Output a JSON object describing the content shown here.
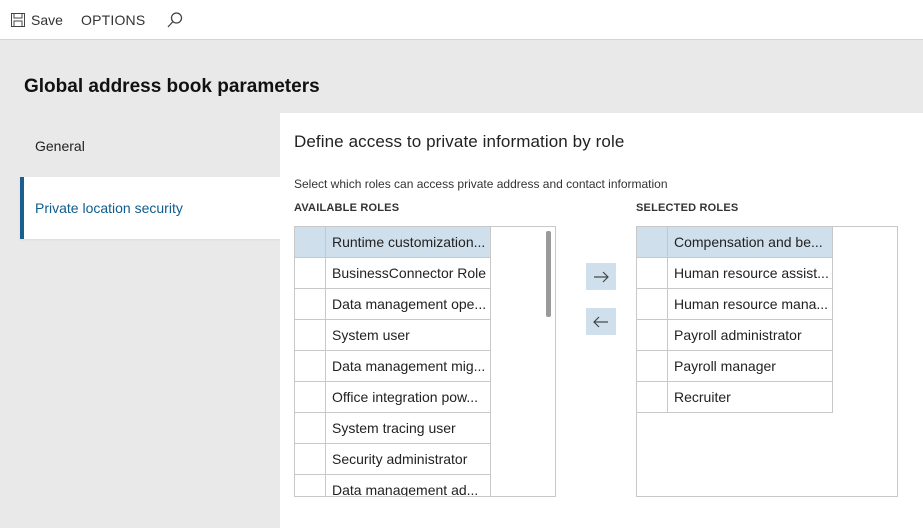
{
  "toolbar": {
    "save_label": "Save",
    "options_label": "OPTIONS",
    "save_icon": "save-icon",
    "search_icon": "search-icon"
  },
  "page": {
    "title": "Global address book parameters"
  },
  "nav": {
    "items": [
      {
        "label": "General",
        "active": false
      },
      {
        "label": "Private location security",
        "active": true
      }
    ]
  },
  "main": {
    "section_title": "Define access to private information by role",
    "instructions": "Select which roles can access private address and contact information",
    "available_label": "AVAILABLE ROLES",
    "selected_label": "SELECTED ROLES",
    "available_roles": [
      "Runtime customization...",
      "BusinessConnector Role",
      "Data management ope...",
      "System user",
      "Data management mig...",
      "Office integration pow...",
      "System tracing user",
      "Security administrator",
      "Data management ad..."
    ],
    "selected_roles": [
      "Compensation and be...",
      "Human resource assist...",
      "Human resource mana...",
      "Payroll administrator",
      "Payroll manager",
      "Recruiter"
    ],
    "add_icon": "arrow-right-icon",
    "remove_icon": "arrow-left-icon"
  },
  "colors": {
    "accent": "#1a5f8f",
    "selection": "#cfe0ec",
    "background": "#e9e9e9"
  }
}
